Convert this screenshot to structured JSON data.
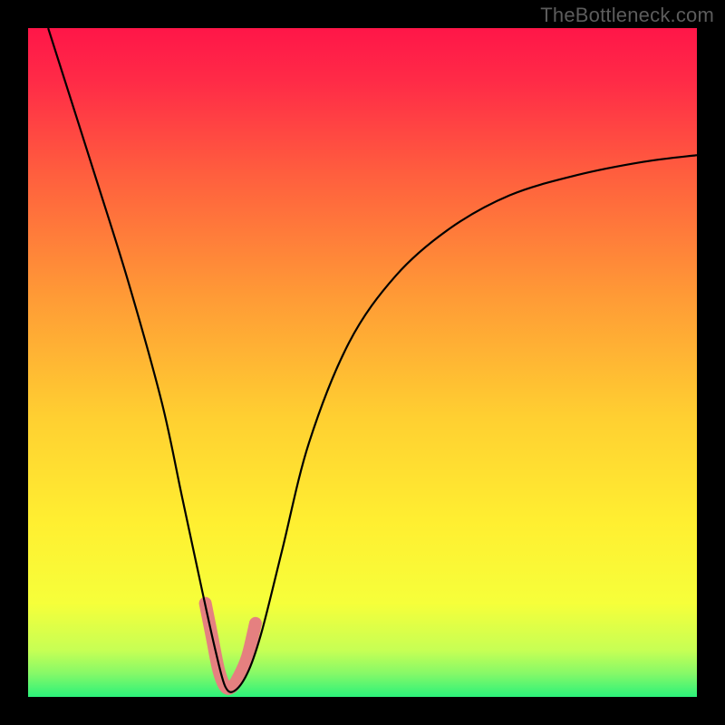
{
  "watermark": "TheBottleneck.com",
  "chart_data": {
    "type": "line",
    "title": "",
    "xlabel": "",
    "ylabel": "",
    "xlim": [
      0,
      100
    ],
    "ylim": [
      0,
      100
    ],
    "gradient_bg": {
      "top_color": "#ff1648",
      "mid_color": "#ffe931",
      "bottom_color": "#2bf27a"
    },
    "series": [
      {
        "name": "bottleneck-curve",
        "color": "#000000",
        "x": [
          3,
          10,
          15,
          20,
          23,
          26,
          28,
          29.5,
          31,
          33,
          35,
          38,
          42,
          48,
          55,
          63,
          72,
          82,
          92,
          100
        ],
        "y": [
          100,
          78,
          62,
          44,
          30,
          16,
          7,
          1.5,
          1,
          4,
          10,
          22,
          38,
          53,
          63,
          70,
          75,
          78,
          80,
          81
        ]
      },
      {
        "name": "highlight-u",
        "color": "#e58080",
        "x": [
          26.5,
          27.5,
          28.5,
          29.5,
          30.5,
          31.5,
          32.8,
          34.0
        ],
        "y": [
          14,
          9,
          4,
          1.5,
          1.5,
          3,
          6,
          11
        ]
      }
    ]
  }
}
